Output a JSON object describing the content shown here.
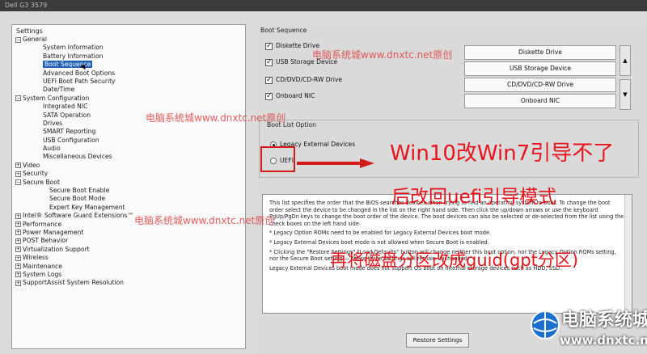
{
  "window": {
    "title": "Dell G3 3579"
  },
  "tree": {
    "title": "Settings",
    "items": [
      {
        "label": "General",
        "level": 0,
        "toggle": "−"
      },
      {
        "label": "System Information",
        "level": 2
      },
      {
        "label": "Battery Information",
        "level": 2
      },
      {
        "label": "Boot Sequence",
        "level": 2,
        "selected": true
      },
      {
        "label": "Advanced Boot Options",
        "level": 2
      },
      {
        "label": "UEFI Boot Path Security",
        "level": 2
      },
      {
        "label": "Date/Time",
        "level": 2
      },
      {
        "label": "System Configuration",
        "level": 0,
        "toggle": "−"
      },
      {
        "label": "Integrated NIC",
        "level": 2
      },
      {
        "label": "SATA Operation",
        "level": 2
      },
      {
        "label": "Drives",
        "level": 2
      },
      {
        "label": "SMART Reporting",
        "level": 2
      },
      {
        "label": "USB Configuration",
        "level": 2
      },
      {
        "label": "Audio",
        "level": 2
      },
      {
        "label": "Miscellaneous Devices",
        "level": 2
      },
      {
        "label": "Video",
        "level": 0,
        "toggle": "+"
      },
      {
        "label": "Security",
        "level": 0,
        "toggle": "+"
      },
      {
        "label": "Secure Boot",
        "level": 0,
        "toggle": "−"
      },
      {
        "label": "Secure Boot Enable",
        "level": 3
      },
      {
        "label": "Secure Boot Mode",
        "level": 3
      },
      {
        "label": "Expert Key Management",
        "level": 3
      },
      {
        "label": "Intel® Software Guard Extensions™",
        "level": 0,
        "toggle": "+"
      },
      {
        "label": "Performance",
        "level": 0,
        "toggle": "+"
      },
      {
        "label": "Power Management",
        "level": 0,
        "toggle": "+"
      },
      {
        "label": "POST Behavior",
        "level": 0,
        "toggle": "+"
      },
      {
        "label": "Virtualization Support",
        "level": 0,
        "toggle": "+"
      },
      {
        "label": "Wireless",
        "level": 0,
        "toggle": "+"
      },
      {
        "label": "Maintenance",
        "level": 0,
        "toggle": "+"
      },
      {
        "label": "System Logs",
        "level": 0,
        "toggle": "+"
      },
      {
        "label": "SupportAssist System Resolution",
        "level": 0,
        "toggle": "+"
      }
    ]
  },
  "boot_sequence": {
    "label": "Boot Sequence",
    "devices": [
      {
        "label": "Diskette Drive",
        "checked": true
      },
      {
        "label": "USB Storage Device",
        "checked": true
      },
      {
        "label": "CD/DVD/CD-RW Drive",
        "checked": true
      },
      {
        "label": "Onboard NIC",
        "checked": true
      }
    ],
    "order": [
      "Diskette Drive",
      "USB Storage Device",
      "CD/DVD/CD-RW Drive",
      "Onboard NIC"
    ]
  },
  "boot_list": {
    "label": "Boot List Option",
    "options": [
      {
        "label": "Legacy External Devices",
        "selected": true
      },
      {
        "label": "UEFI",
        "selected": false
      }
    ]
  },
  "description": {
    "p1": "This list specifies the order that the BIOS searches devices when trying to find an operating system to boot. To change the boot order select the device to be changed in the list on the right hand side. Then click the up/down arrows or use the keyboard PgUp/PgDn keys to change the boot order of the device. The boot devices can also be selected or de-selected from the list using the check boxes on the left hand side.",
    "p2": "* Legacy Option ROMs need to be enabled for Legacy External Devices boot mode.",
    "p3": "* Legacy External Devices boot mode is not allowed when Secure Boot is enabled.",
    "p4": "* Clicking the \"Restore Settings\" \"Load Defaults\" button will change neither this boot option, nor the Legacy Option ROMs setting, nor the Secure Boot setting — these three settings will remain unchanged.",
    "p5": "Legacy External Devices boot mode does not support OS boot on internal storage devices such as HDD, SSD."
  },
  "buttons": {
    "restore": "Restore Settings"
  },
  "overlay": {
    "line1": "Win10改Win7引导不了",
    "line2": "后改回uefi引导模式",
    "line3": "再将磁盘分区改成guid(gpt分区)"
  },
  "watermarks": {
    "wm1": "电脑系统城www.dnxtc.net原创",
    "wm2": "电脑系统城www.dnxtc.net原创",
    "wm3": "电脑系统城www.dnxtc.net原创"
  },
  "logo": {
    "name": "电脑系统城",
    "url": "www.dnxtc.net"
  },
  "colors": {
    "accent": "#1f5fb8",
    "overlay": "#e8141c",
    "frame": "#d21c1c"
  }
}
